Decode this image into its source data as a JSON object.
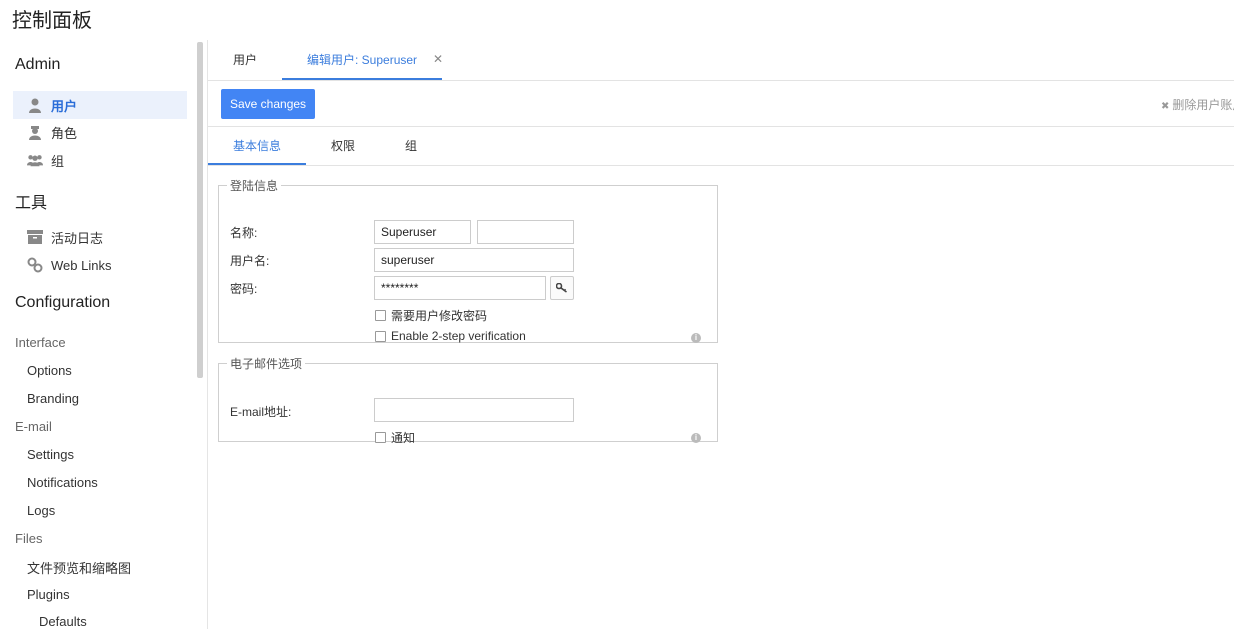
{
  "app": {
    "title": "控制面板"
  },
  "sidebar": {
    "admin_heading": "Admin",
    "admin_items": [
      {
        "label": "用户",
        "icon": "user-icon",
        "active": true
      },
      {
        "label": "角色",
        "icon": "role-icon"
      },
      {
        "label": "组",
        "icon": "group-icon"
      }
    ],
    "tools_heading": "工具",
    "tools_items": [
      {
        "label": "活动日志",
        "icon": "archive-icon"
      },
      {
        "label": "Web Links",
        "icon": "link-icon"
      }
    ],
    "config_heading": "Configuration",
    "groups": [
      {
        "label": "Interface",
        "items": [
          "Options",
          "Branding"
        ]
      },
      {
        "label": "E-mail",
        "items": [
          "Settings",
          "Notifications",
          "Logs"
        ]
      },
      {
        "label": "Files",
        "items": [
          "文件预览和缩略图",
          "Plugins",
          "Defaults"
        ]
      }
    ]
  },
  "tabs": [
    {
      "label": "用户"
    },
    {
      "label": "编辑用户: Superuser",
      "active": true
    }
  ],
  "toolbar": {
    "save_label": "Save changes",
    "delete_label": "删除用户账户"
  },
  "subtabs": [
    {
      "label": "基本信息",
      "active": true
    },
    {
      "label": "权限"
    },
    {
      "label": "组"
    }
  ],
  "login_section": {
    "legend": "登陆信息",
    "name_label": "名称:",
    "first_name": "Superuser",
    "last_name": "",
    "username_label": "用户名:",
    "username": "superuser",
    "password_label": "密码:",
    "password": "********",
    "require_change_label": "需要用户修改密码",
    "two_step_label": "Enable 2-step verification"
  },
  "email_section": {
    "legend": "电子邮件选项",
    "email_label": "E-mail地址:",
    "email": "",
    "notify_label": "通知"
  },
  "colors": {
    "accent": "#4285f4",
    "active_text": "#3b7ddd",
    "active_bg": "#ebf1fc"
  }
}
